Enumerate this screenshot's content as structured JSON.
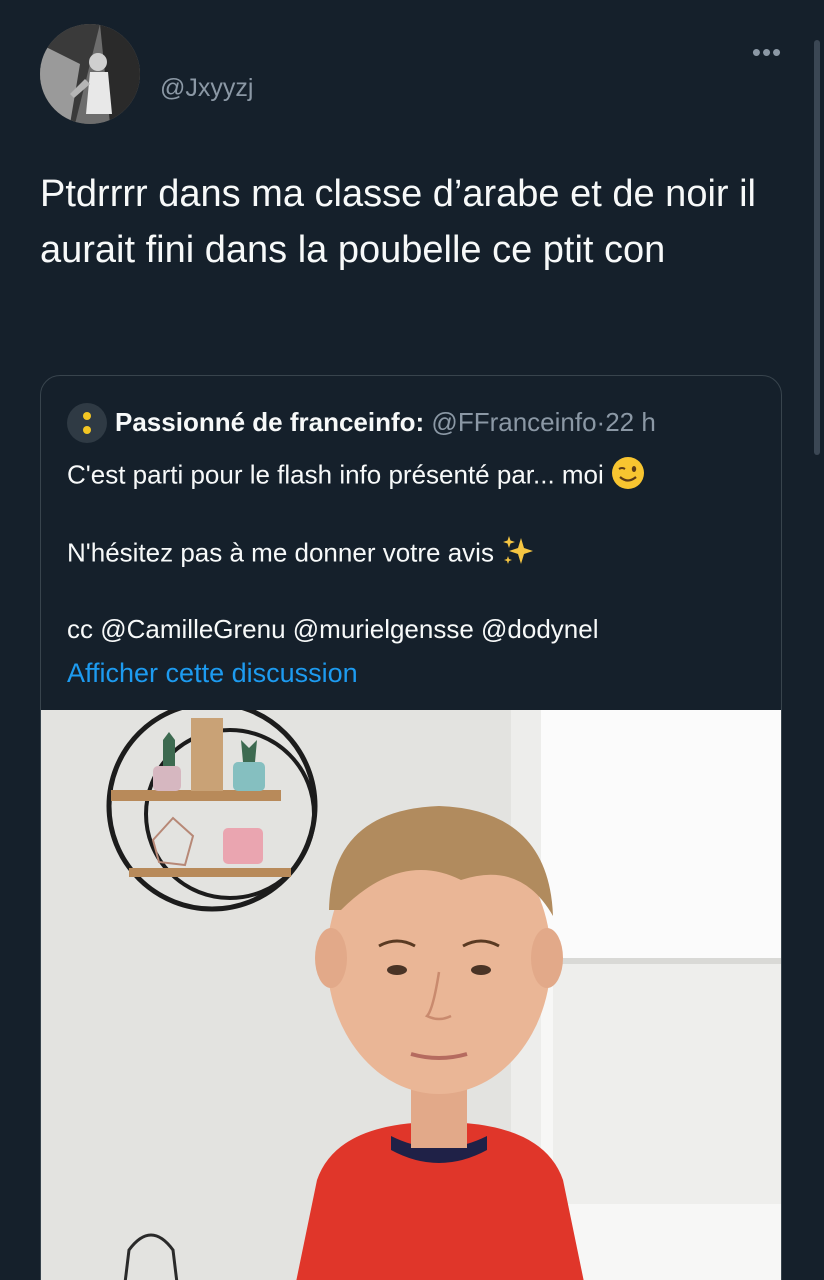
{
  "tweet": {
    "handle": "@Jxyyzj",
    "more_icon": "•••",
    "text": "Ptdrrrr dans ma classe d’arabe et de noir il aurait fini dans la poubelle ce ptit con"
  },
  "quoted": {
    "name": "Passionné de franceinfo:",
    "handle": "@FFranceinfo",
    "separator": "·",
    "time": "22 h",
    "line1": "C'est parti pour le flash info présenté par... moi",
    "line2": "N'hésitez pas à me donner votre avis",
    "line3": "cc @CamilleGrenu @murielgensse @dodynel",
    "show_thread": "Afficher cette discussion",
    "emoji1": "winking-face-emoji",
    "emoji2": "sparkles-emoji"
  },
  "colors": {
    "background": "#15202b",
    "link": "#1d9bf0",
    "muted": "#8b98a5",
    "border": "#38444d"
  }
}
